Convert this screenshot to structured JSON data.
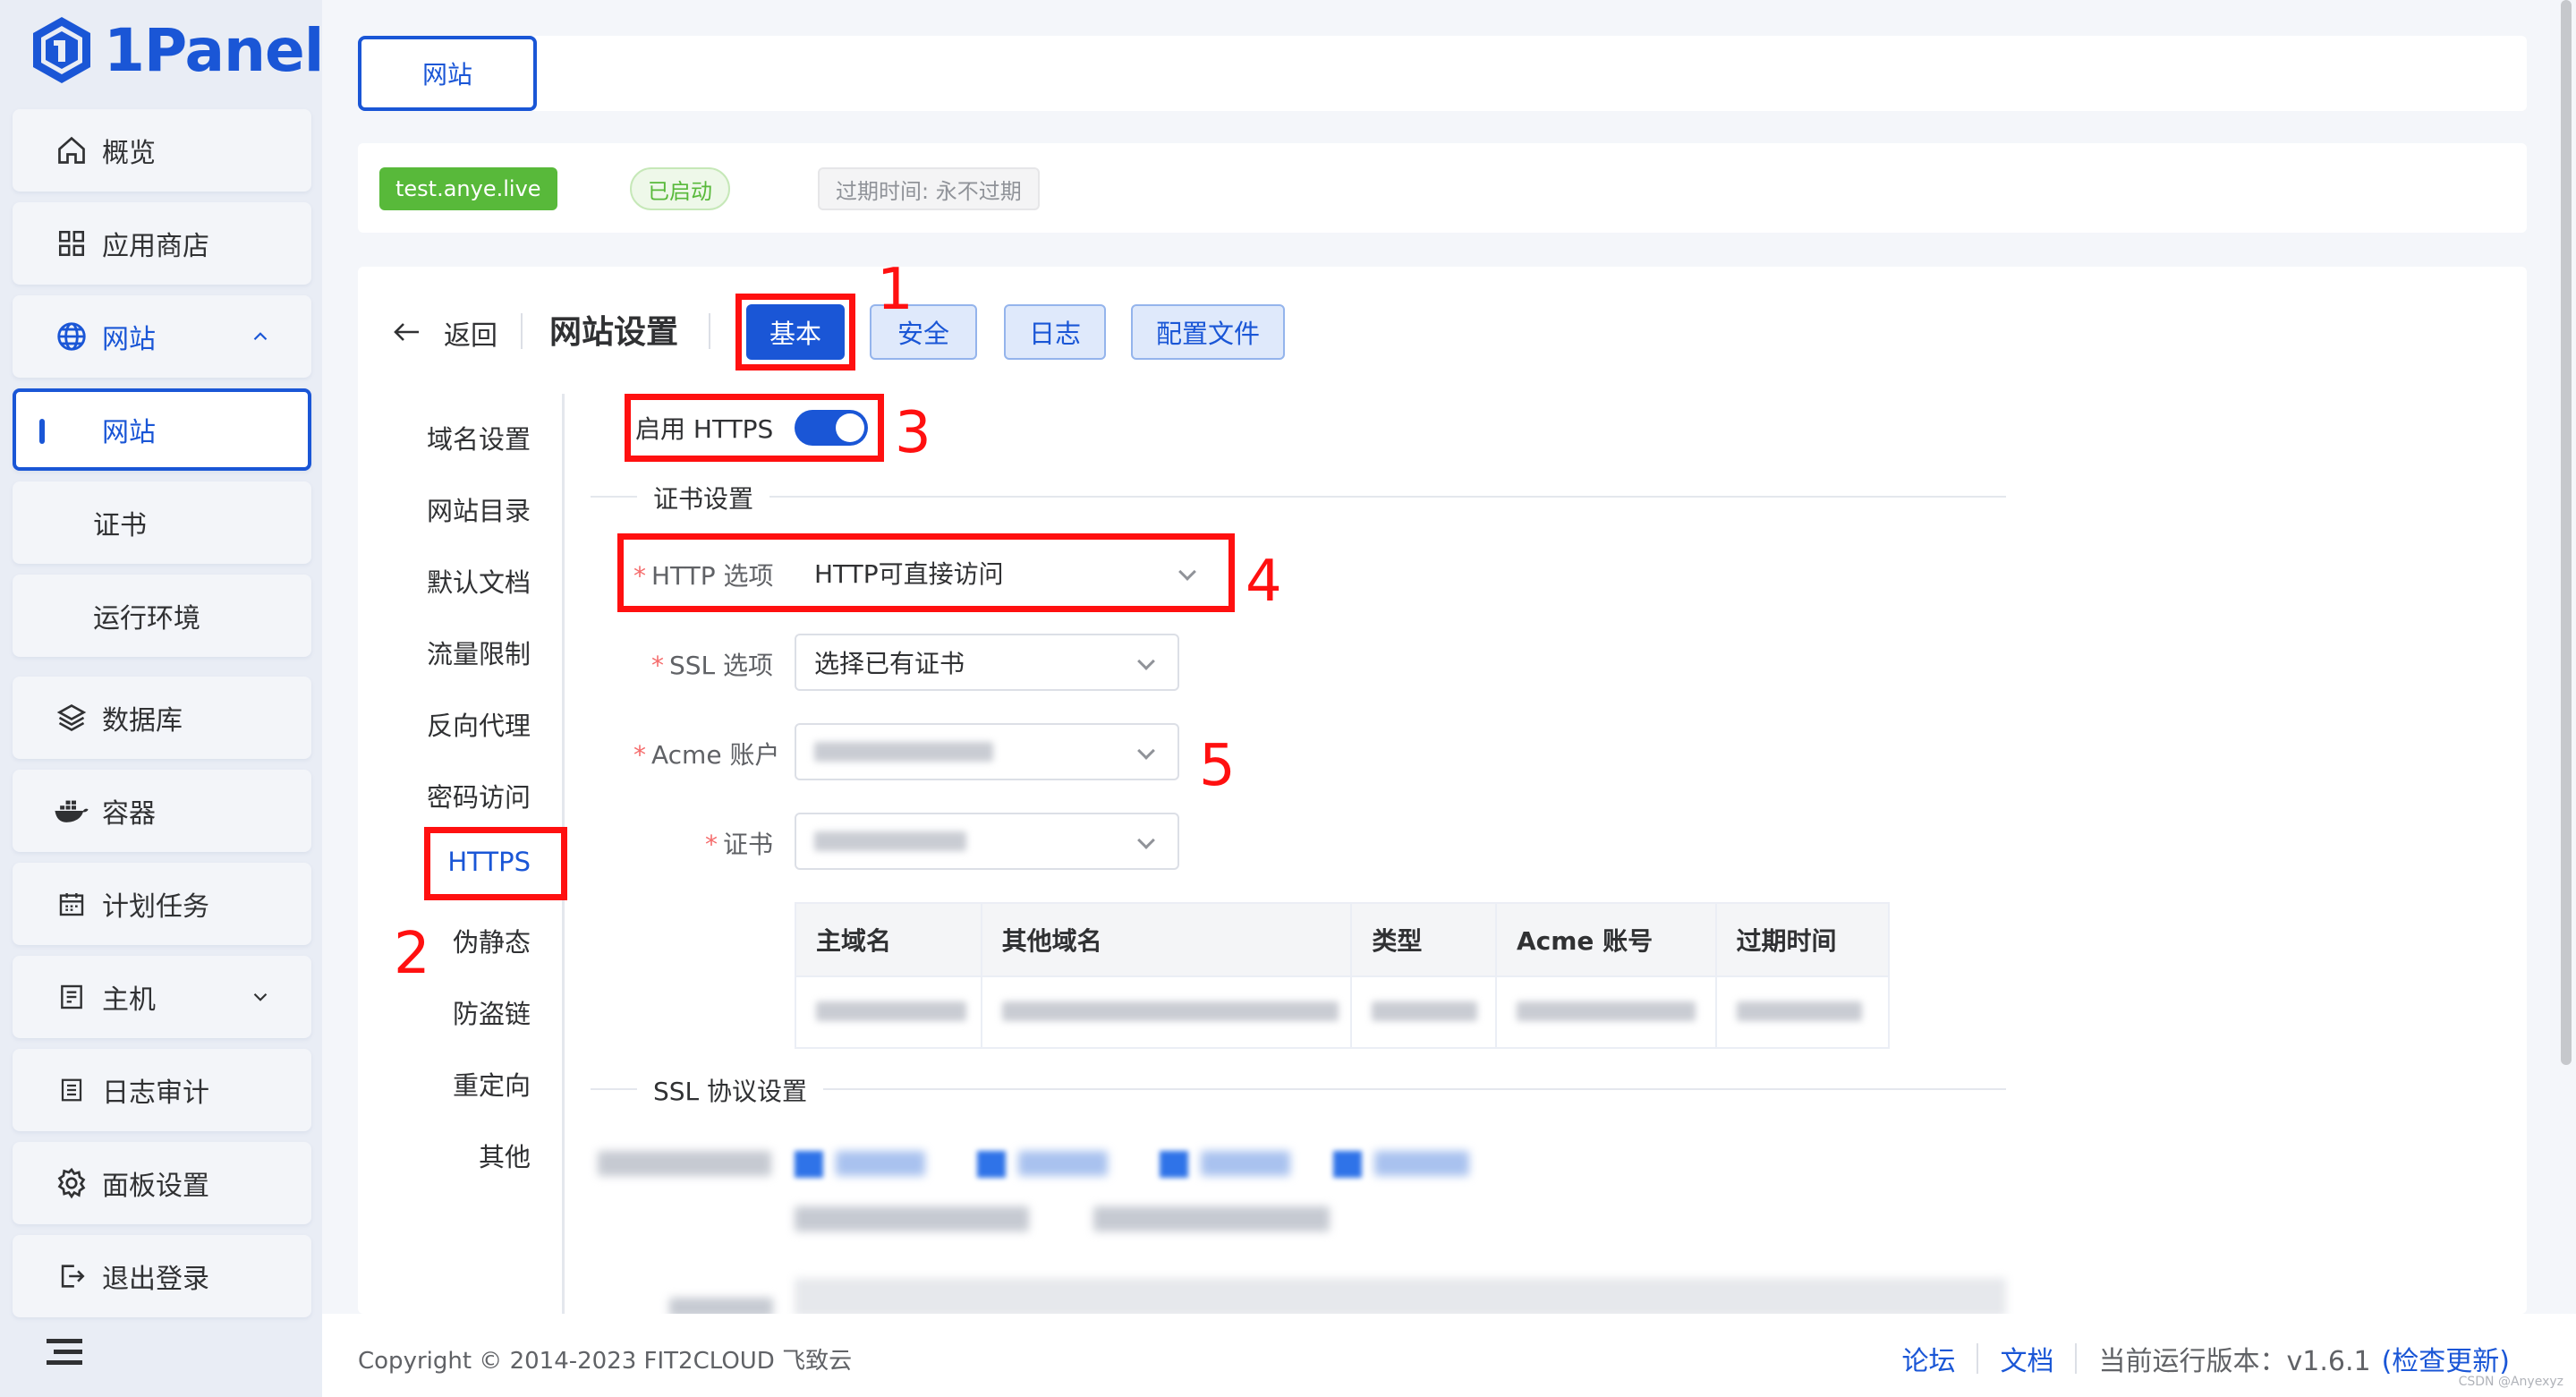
{
  "app": {
    "name": "1Panel"
  },
  "sidebar": {
    "items": [
      {
        "label": "概览",
        "icon": "home-icon"
      },
      {
        "label": "应用商店",
        "icon": "grid-icon"
      },
      {
        "label": "网站",
        "icon": "globe-icon"
      },
      {
        "label": "网站",
        "icon": ""
      },
      {
        "label": "证书",
        "icon": ""
      },
      {
        "label": "运行环境",
        "icon": ""
      },
      {
        "label": "数据库",
        "icon": "layers-icon"
      },
      {
        "label": "容器",
        "icon": "docker-icon"
      },
      {
        "label": "计划任务",
        "icon": "calendar-icon"
      },
      {
        "label": "主机",
        "icon": "host-icon"
      },
      {
        "label": "日志审计",
        "icon": "log-icon"
      },
      {
        "label": "面板设置",
        "icon": "gear-icon"
      },
      {
        "label": "退出登录",
        "icon": "logout-icon"
      }
    ]
  },
  "tabs": [
    {
      "label": "网站"
    }
  ],
  "site_info": {
    "domain": "test.anye.live",
    "status": "已启动",
    "expire": "过期时间: 永不过期",
    "status_color": "#58b93a"
  },
  "header": {
    "back_label": "返回",
    "title": "网站设置",
    "buttons": [
      "基本",
      "安全",
      "日志",
      "配置文件"
    ]
  },
  "left_menu": [
    "域名设置",
    "网站目录",
    "默认文档",
    "流量限制",
    "反向代理",
    "密码访问",
    "HTTPS",
    "伪静态",
    "防盗链",
    "重定向",
    "其他"
  ],
  "form": {
    "https_label": "启用 HTTPS",
    "https_enabled": true,
    "cert_section": "证书设置",
    "http_option_label": "HTTP 选项",
    "http_option_value": "HTTP可直接访问",
    "ssl_option_label": "SSL 选项",
    "ssl_option_value": "选择已有证书",
    "acme_label": "Acme 账户",
    "cert_label": "证书",
    "ssl_protocol_section": "SSL 协议设置"
  },
  "cert_table": {
    "headers": [
      "主域名",
      "其他域名",
      "类型",
      "Acme 账号",
      "过期时间"
    ]
  },
  "annotations": [
    "1",
    "2",
    "3",
    "4",
    "5"
  ],
  "footer": {
    "copyright": "Copyright © 2014-2023 FIT2CLOUD 飞致云",
    "forum": "论坛",
    "docs": "文档",
    "version": "当前运行版本：v1.6.1",
    "check_update": "(检查更新)",
    "watermark": "CSDN @Anyexyz"
  },
  "colors": {
    "primary": "#1a56d6",
    "annotation": "#ff1010",
    "success": "#58b93a"
  }
}
